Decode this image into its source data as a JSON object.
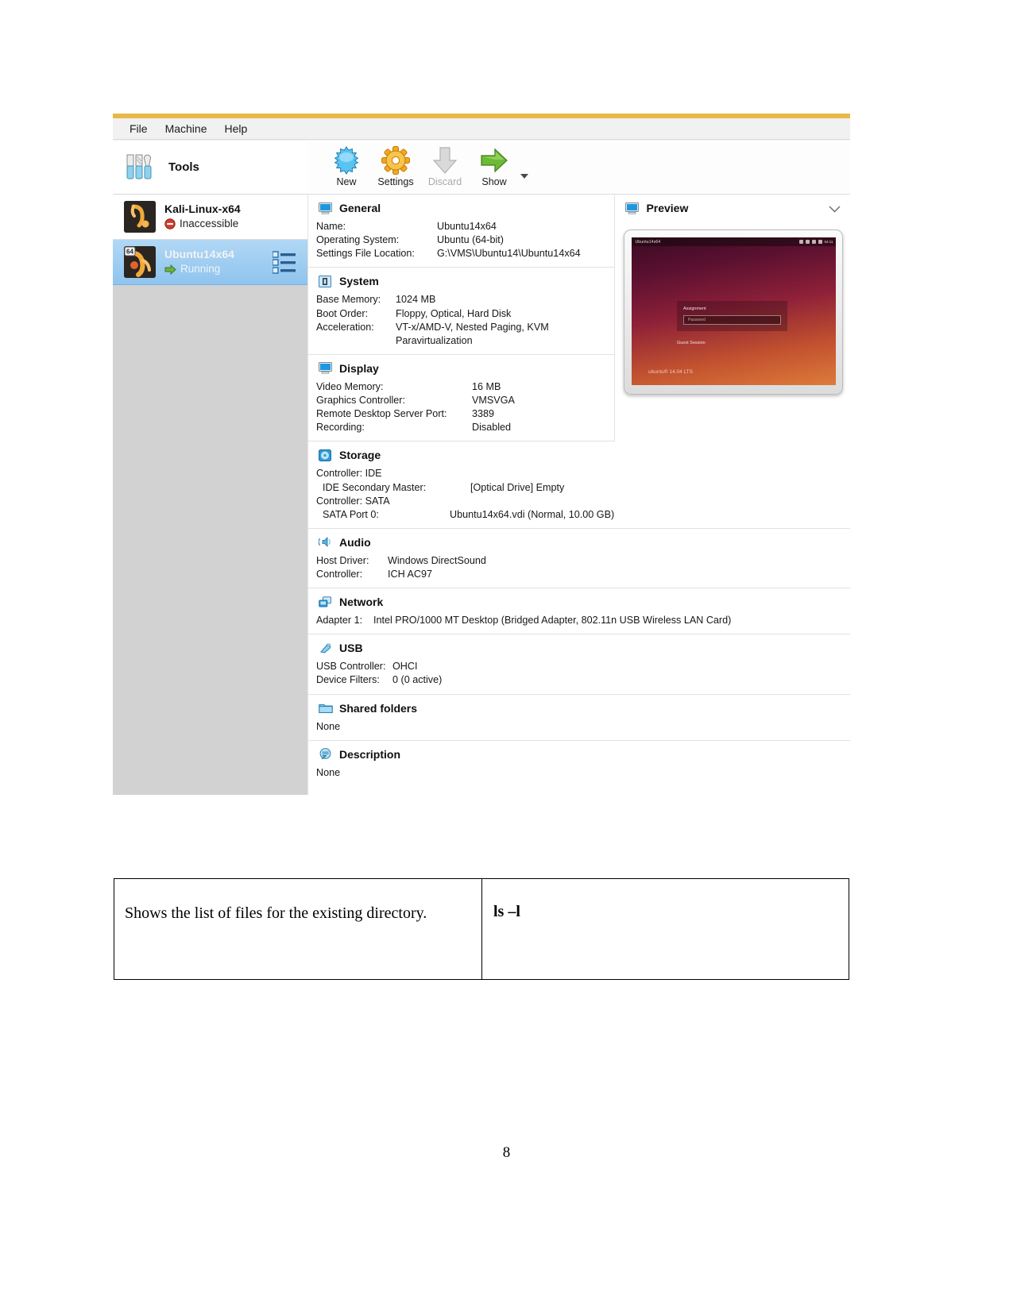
{
  "document": {
    "page_number": "8",
    "table": {
      "description": "Shows the list of files for the existing directory.",
      "command": "ls –l"
    }
  },
  "vbox": {
    "menubar": [
      {
        "label": "File",
        "name": "menu-file"
      },
      {
        "label": "Machine",
        "name": "menu-machine"
      },
      {
        "label": "Help",
        "name": "menu-help"
      }
    ],
    "sidebar": {
      "tools_label": "Tools",
      "machines": [
        {
          "name": "Kali-Linux-x64",
          "state": "Inaccessible",
          "state_icon": "inaccessible-icon",
          "selected": false,
          "badge": ""
        },
        {
          "name": "Ubuntu14x64",
          "state": "Running",
          "state_icon": "running-arrow-icon",
          "selected": true,
          "badge": "64"
        }
      ]
    },
    "toolbar": [
      {
        "label": "New",
        "icon": "new-star-icon",
        "disabled": false
      },
      {
        "label": "Settings",
        "icon": "gear-icon",
        "disabled": false
      },
      {
        "label": "Discard",
        "icon": "discard-arrow-icon",
        "disabled": true
      },
      {
        "label": "Show",
        "icon": "show-arrow-icon",
        "disabled": false
      }
    ],
    "details": {
      "general": {
        "title": "General",
        "rows": [
          {
            "key": "Name:",
            "value": "Ubuntu14x64"
          },
          {
            "key": "Operating System:",
            "value": "Ubuntu (64-bit)"
          },
          {
            "key": "Settings File Location:",
            "value": "G:\\VMS\\Ubuntu14\\Ubuntu14x64"
          }
        ]
      },
      "system": {
        "title": "System",
        "rows": [
          {
            "key": "Base Memory:",
            "value": "1024 MB"
          },
          {
            "key": "Boot Order:",
            "value": "Floppy, Optical, Hard Disk"
          },
          {
            "key": "Acceleration:",
            "value": "VT-x/AMD-V, Nested Paging, KVM"
          }
        ],
        "continuation": "Paravirtualization"
      },
      "display": {
        "title": "Display",
        "rows": [
          {
            "key": "Video Memory:",
            "value": "16 MB"
          },
          {
            "key": "Graphics Controller:",
            "value": "VMSVGA"
          },
          {
            "key": "Remote Desktop Server Port:",
            "value": "3389"
          },
          {
            "key": "Recording:",
            "value": "Disabled"
          }
        ]
      },
      "storage": {
        "title": "Storage",
        "controller_ide": "Controller: IDE",
        "ide_row": {
          "key": "IDE Secondary Master:",
          "value": "[Optical Drive] Empty"
        },
        "controller_sata": "Controller: SATA",
        "sata_row": {
          "key": "SATA Port 0:",
          "value": "Ubuntu14x64.vdi (Normal, 10.00 GB)"
        }
      },
      "audio": {
        "title": "Audio",
        "rows": [
          {
            "key": "Host Driver:",
            "value": "Windows DirectSound"
          },
          {
            "key": "Controller:",
            "value": "ICH AC97"
          }
        ]
      },
      "network": {
        "title": "Network",
        "rows": [
          {
            "key": "Adapter 1:",
            "value": "Intel PRO/1000 MT Desktop (Bridged Adapter, 802.11n USB Wireless LAN Card)"
          }
        ]
      },
      "usb": {
        "title": "USB",
        "rows": [
          {
            "key": "USB Controller:",
            "value": "OHCI"
          },
          {
            "key": "Device Filters:",
            "value": "0 (0 active)"
          }
        ]
      },
      "shared_folders": {
        "title": "Shared folders",
        "value": "None"
      },
      "description": {
        "title": "Description",
        "value": "None"
      }
    },
    "preview": {
      "title": "Preview",
      "guest_screen": {
        "topbar_title": "Ubuntu14x64",
        "clock": "04:11",
        "user": "Assignment",
        "password_placeholder": "Password",
        "guest_session": "Guest Session",
        "brand": "ubuntu® 14.04 LTS"
      }
    }
  },
  "colors": {
    "accent_orange": "#e8b84b",
    "selection_blue": "#8fc4ee",
    "running_green": "#6cb33f",
    "inaccessible_red": "#d03c2c"
  }
}
